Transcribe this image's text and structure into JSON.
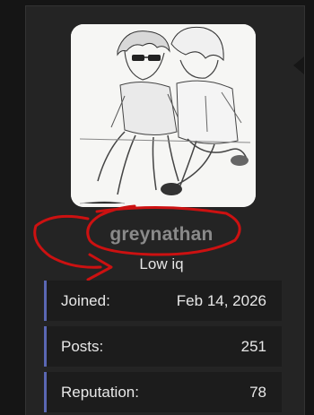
{
  "profile": {
    "username": "greynathan",
    "user_title": "Low iq",
    "avatar_icon": "manga-sketch-avatar-icon"
  },
  "stats": [
    {
      "label": "Joined:",
      "value": "Feb 14, 2026"
    },
    {
      "label": "Posts:",
      "value": "251"
    },
    {
      "label": "Reputation:",
      "value": "78"
    }
  ],
  "colors": {
    "background": "#151515",
    "panel": "#242424",
    "row_background": "#1c1c1c",
    "row_accent": "#5a67b3",
    "username": "#8a8a8a",
    "annotation": "#cc1111"
  }
}
